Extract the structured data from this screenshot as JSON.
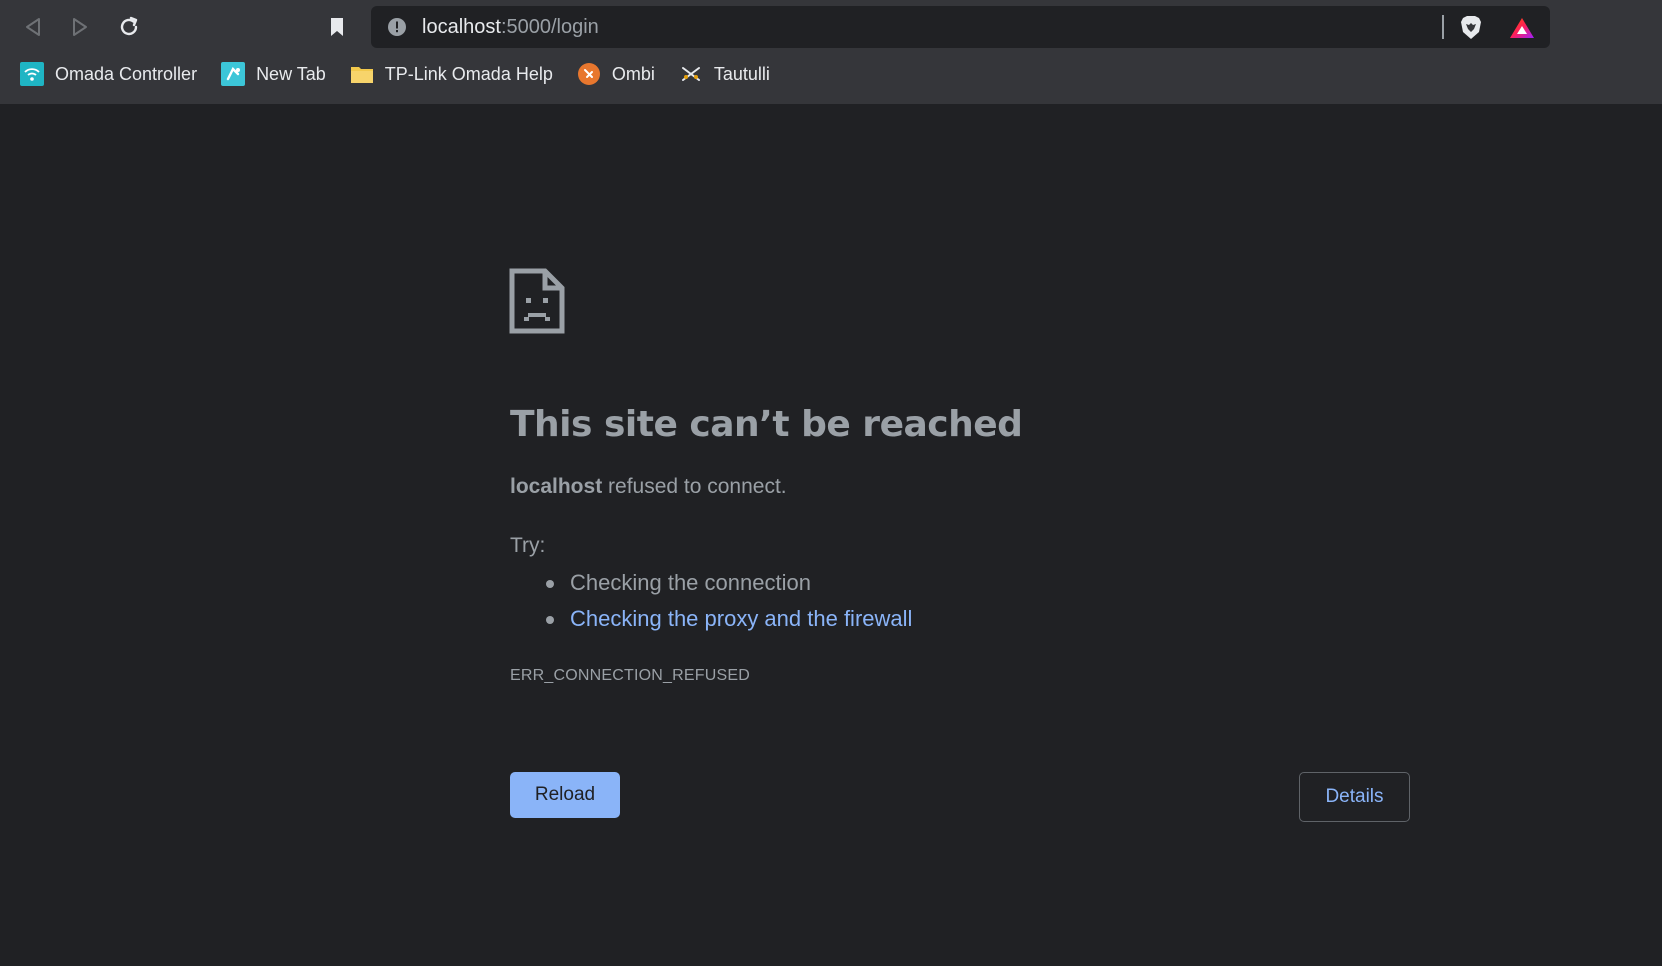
{
  "browser": {
    "url_host": "localhost",
    "url_rest": ":5000/login"
  },
  "bookmarks": [
    {
      "label": "Omada Controller",
      "icon": "wifi-icon"
    },
    {
      "label": "New Tab",
      "icon": "new-tab-icon"
    },
    {
      "label": "TP-Link Omada Help",
      "icon": "folder-icon"
    },
    {
      "label": "Ombi",
      "icon": "ombi-icon"
    },
    {
      "label": "Tautulli",
      "icon": "tautulli-icon"
    }
  ],
  "error": {
    "title": "This site can’t be reached",
    "host": "localhost",
    "message": " refused to connect.",
    "try_label": "Try:",
    "suggestion_1": "Checking the connection",
    "suggestion_2": "Checking the proxy and the firewall",
    "code": "ERR_CONNECTION_REFUSED",
    "reload_label": "Reload",
    "details_label": "Details"
  },
  "colors": {
    "background": "#202124",
    "chrome": "#35363a",
    "link": "#8ab4f8",
    "text": "#9aa0a6"
  }
}
